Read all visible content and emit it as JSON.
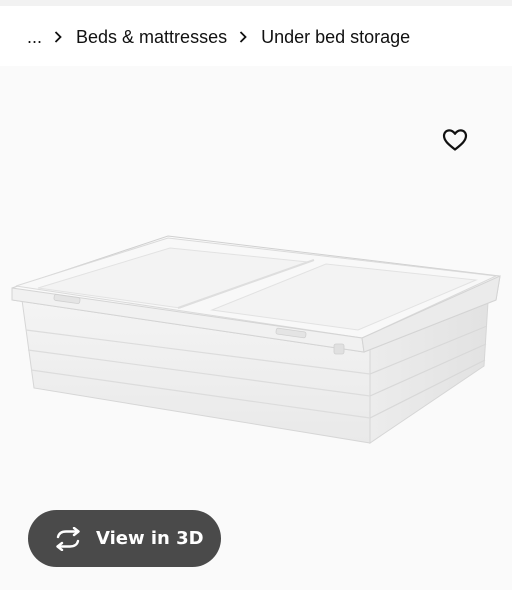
{
  "breadcrumb": {
    "items": [
      "...",
      "Beds & mattresses",
      "Under bed storage"
    ]
  },
  "product": {
    "image_icon": "under-bed-storage-box-image"
  },
  "favourite": {
    "icon": "heart-outline-icon"
  },
  "view3d": {
    "label": "View in 3D",
    "icon": "rotate-arrows-icon",
    "background": "#4a4a4a",
    "text_color": "#ffffff"
  },
  "colors": {
    "stage_background": "#fafafa",
    "top_strip": "#f2f2f2"
  }
}
